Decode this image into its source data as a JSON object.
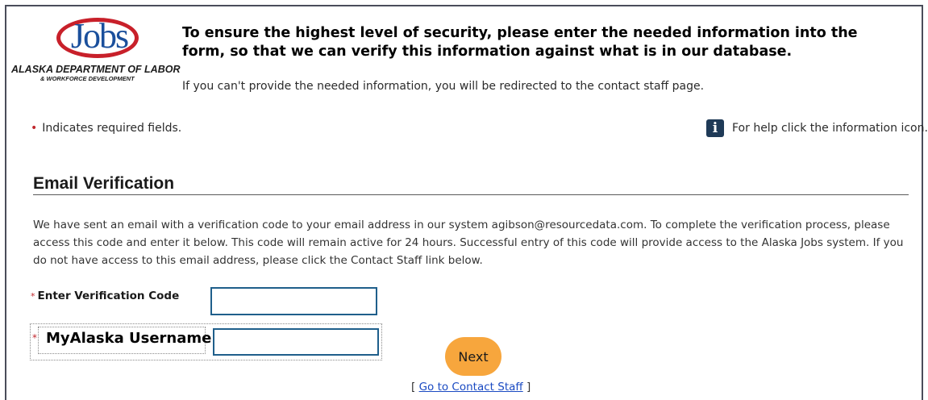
{
  "logo": {
    "wordmark": "Jobs",
    "org_line1": "ALASKA DEPARTMENT OF LABOR",
    "org_line2": "& WORKFORCE DEVELOPMENT"
  },
  "header": {
    "headline": "To ensure the highest level of security, please enter the needed information into the form, so that we can verify this information against what is in our database.",
    "subline": "If you can't provide the needed information, you will be redirected to the contact staff page."
  },
  "notes": {
    "required_marker": "•",
    "required_text": "Indicates required fields.",
    "help_icon": "info-icon",
    "help_text": "For help click the information icon."
  },
  "section": {
    "title": "Email Verification",
    "body": "We have sent an email with a verification code to your email address in our system agibson@resourcedata.com. To complete the verification process, please access this code and enter it below. This code will remain active for 24 hours. Successful entry of this code will provide access to the Alaska Jobs system. If you do not have access to this email address, please click the Contact Staff link below."
  },
  "form": {
    "required_star": "*",
    "code_label": "Enter Verification Code",
    "code_value": "",
    "username_label": "MyAlaska Username",
    "username_value": "",
    "next_label": "Next"
  },
  "footer": {
    "bracket_open": "[",
    "contact_link": "Go to Contact Staff",
    "bracket_close": "]"
  },
  "colors": {
    "frame": "#4a4d5a",
    "required": "#c0272d",
    "input_border": "#1f5f8b",
    "next_button": "#f7a63d",
    "link": "#1a4ac2",
    "logo_blue": "#1a4f9c",
    "logo_red": "#c8202a"
  }
}
